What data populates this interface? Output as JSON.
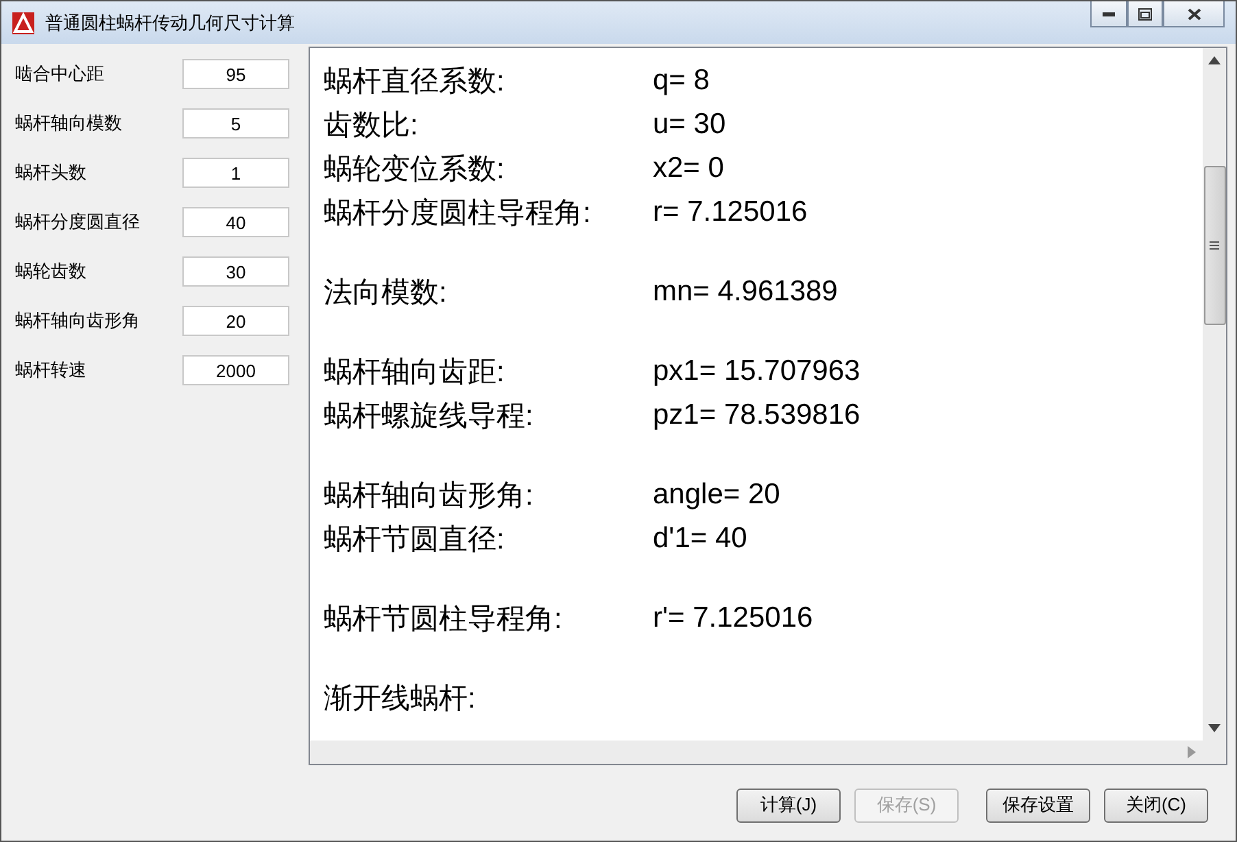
{
  "window": {
    "title": "普通圆柱蜗杆传动几何尺寸计算"
  },
  "inputs": [
    {
      "label": "啮合中心距",
      "value": "95"
    },
    {
      "label": "蜗杆轴向模数",
      "value": "5"
    },
    {
      "label": "蜗杆头数",
      "value": "1"
    },
    {
      "label": "蜗杆分度圆直径",
      "value": "40"
    },
    {
      "label": "蜗轮齿数",
      "value": "30"
    },
    {
      "label": "蜗杆轴向齿形角",
      "value": "20"
    },
    {
      "label": "蜗杆转速",
      "value": "2000"
    }
  ],
  "output": [
    [
      {
        "label": "蜗杆直径系数:",
        "value": "q= 8"
      },
      {
        "label": "齿数比:",
        "value": "u= 30"
      },
      {
        "label": "蜗轮变位系数:",
        "value": "x2= 0"
      },
      {
        "label": "蜗杆分度圆柱导程角:",
        "value": "r= 7.125016"
      }
    ],
    [
      {
        "label": "法向模数:",
        "value": "mn= 4.961389"
      }
    ],
    [
      {
        "label": "蜗杆轴向齿距:",
        "value": "px1= 15.707963"
      },
      {
        "label": "蜗杆螺旋线导程:",
        "value": "pz1= 78.539816"
      }
    ],
    [
      {
        "label": "蜗杆轴向齿形角:",
        "value": "angle= 20"
      },
      {
        "label": "蜗杆节圆直径:",
        "value": "d'1= 40"
      }
    ],
    [
      {
        "label": "蜗杆节圆柱导程角:",
        "value": "r'= 7.125016"
      }
    ],
    [
      {
        "label": "渐开线蜗杆:"
      }
    ]
  ],
  "buttons": [
    {
      "label": "计算(J)",
      "disabled": false
    },
    {
      "label": "保存(S)",
      "disabled": true
    },
    {
      "label": "保存设置",
      "disabled": false
    },
    {
      "label": "关闭(C)",
      "disabled": false
    }
  ]
}
